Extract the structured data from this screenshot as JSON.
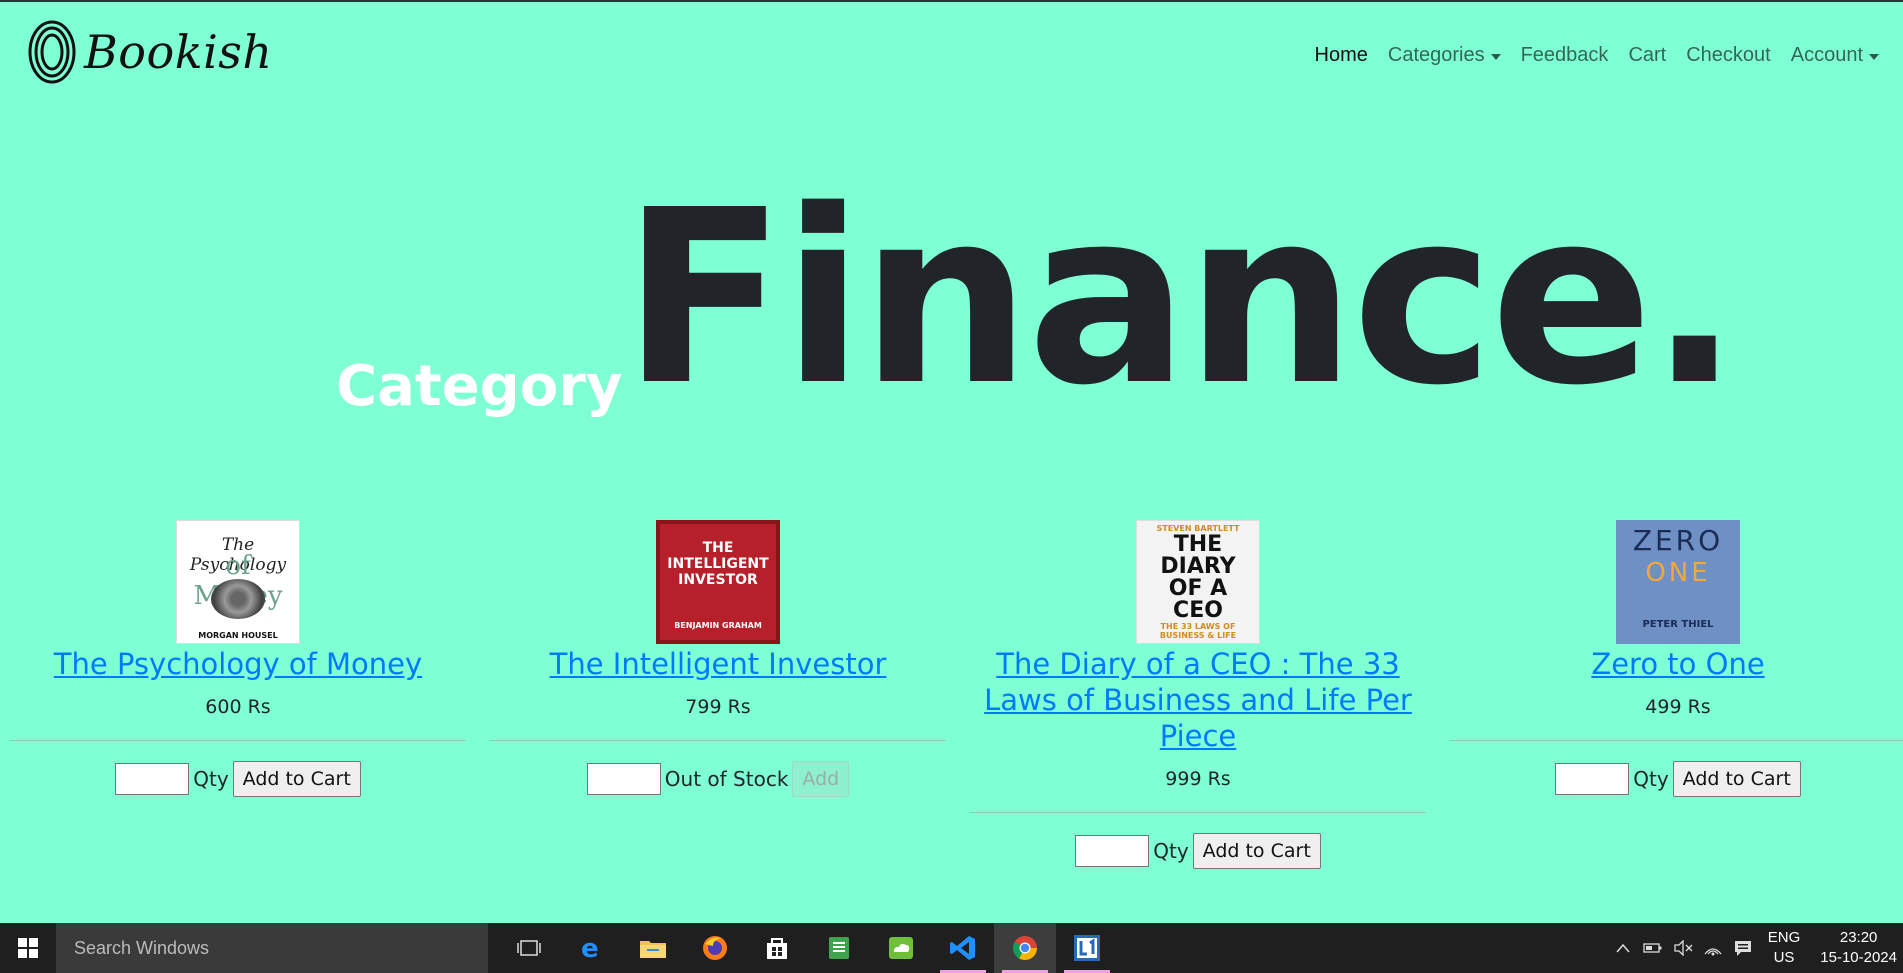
{
  "brand": {
    "name": "Bookish"
  },
  "nav": {
    "home": "Home",
    "categories": "Categories",
    "feedback": "Feedback",
    "cart": "Cart",
    "checkout": "Checkout",
    "account": "Account"
  },
  "hero": {
    "label": "Category",
    "title": "Finance."
  },
  "products": [
    {
      "title": "The Psychology of Money",
      "price": "600 Rs",
      "stock_label": "Qty",
      "button": "Add to Cart"
    },
    {
      "title": "The Intelligent Investor",
      "price": "799 Rs",
      "stock_label": "Out of Stock",
      "button": "Add"
    },
    {
      "title": "The Diary of a CEO : The 33 Laws of Business and Life Per Piece",
      "price": "999 Rs",
      "stock_label": "Qty",
      "button": "Add to Cart"
    },
    {
      "title": "Zero to One",
      "price": "499 Rs",
      "stock_label": "Qty",
      "button": "Add to Cart"
    }
  ],
  "covers": {
    "c1": {
      "line1": "The",
      "line2": "Psychology",
      "line3": "of",
      "line4": "Money",
      "author": "MORGAN HOUSEL"
    },
    "c2": {
      "line1": "THE",
      "line2": "INTELLIGENT",
      "line3": "INVESTOR",
      "author": "BENJAMIN GRAHAM"
    },
    "c3": {
      "top": "STEVEN BARTLETT",
      "line1": "THE",
      "line2": "DIARY",
      "line3": "OF A",
      "line4": "CEO",
      "sub": "THE 33 LAWS OF BUSINESS & LIFE"
    },
    "c4": {
      "line1": "ZERO",
      "line2": "ONE",
      "author": "PETER THIEL"
    }
  },
  "taskbar": {
    "search_placeholder": "Search Windows",
    "lang_top": "ENG",
    "lang_bottom": "US",
    "time": "23:20",
    "date": "15-10-2024",
    "apps": [
      "task-view",
      "edge",
      "file-explorer",
      "firefox",
      "store",
      "notes",
      "cloud",
      "vscode",
      "chrome",
      "launcher"
    ]
  },
  "colors": {
    "background": "#7fffd4",
    "link": "#007bff",
    "taskbar": "#1f1f1f"
  }
}
